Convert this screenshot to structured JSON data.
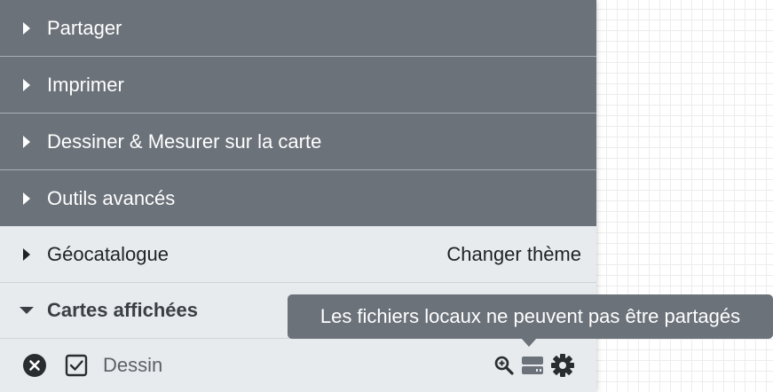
{
  "menu": {
    "items": [
      {
        "label": "Partager",
        "icon": "caret-right-icon"
      },
      {
        "label": "Imprimer",
        "icon": "caret-right-icon"
      },
      {
        "label": "Dessiner & Mesurer sur la carte",
        "icon": "caret-right-icon"
      },
      {
        "label": "Outils avancés",
        "icon": "caret-right-icon"
      }
    ],
    "geocatalogue": {
      "label": "Géocatalogue",
      "action": "Changer thème",
      "icon": "caret-right-icon"
    },
    "displayed_maps": {
      "label": "Cartes affichées",
      "icon": "caret-down-icon"
    }
  },
  "layer": {
    "name": "Dessin",
    "checked": true,
    "icons": [
      "remove-circle-icon",
      "checkbox-icon",
      "zoom-in-icon",
      "hard-drive-icon",
      "gear-icon"
    ]
  },
  "tooltip": {
    "text": "Les fichiers locaux ne peuvent pas être partagés"
  },
  "colors": {
    "menu_dark": "#6b727a",
    "menu_light": "#e7ebee",
    "tooltip_bg": "#6b727a"
  }
}
